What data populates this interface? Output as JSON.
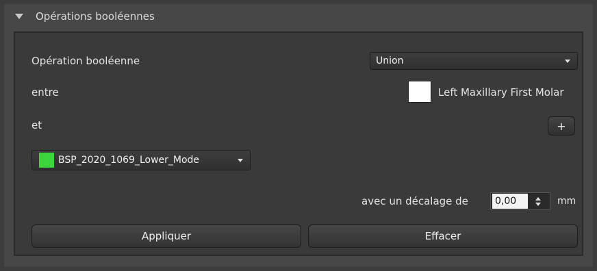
{
  "header": {
    "title": "Opérations booléennes"
  },
  "form": {
    "operation_label": "Opération booléenne",
    "operation_value": "Union",
    "between_label": "entre",
    "between_value": "Left Maxillary First Molar",
    "and_label": "et",
    "add_label": "+",
    "model_value": "BSP_2020_1069_Lower_Mode",
    "model_color": "#3cd63c",
    "offset_label": "avec un décalage de",
    "offset_value": "0,00",
    "offset_unit": "mm"
  },
  "buttons": {
    "apply": "Appliquer",
    "clear": "Effacer"
  }
}
